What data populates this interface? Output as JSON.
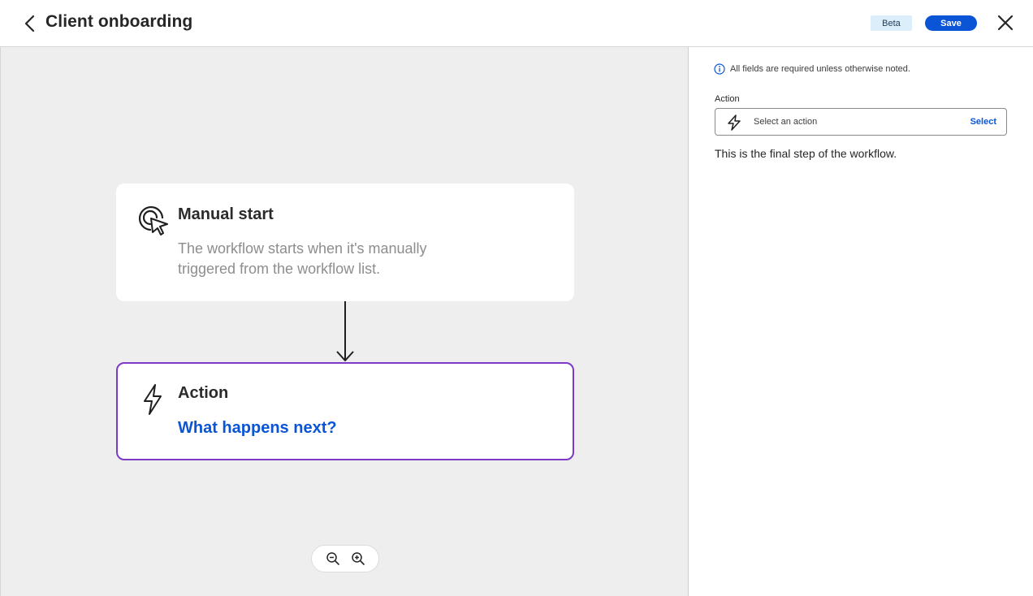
{
  "header": {
    "title": "Client onboarding",
    "beta_label": "Beta",
    "save_label": "Save"
  },
  "canvas": {
    "manual_start": {
      "title": "Manual start",
      "description": "The workflow starts when it's manually triggered from the workflow list."
    },
    "action_card": {
      "title": "Action",
      "link": "What happens next?"
    }
  },
  "panel": {
    "info": "All fields are required unless otherwise noted.",
    "action_label": "Action",
    "action_placeholder": "Select an action",
    "select_link": "Select",
    "final_note": "This is the final step of the workflow."
  },
  "colors": {
    "accent": "#0a54d6",
    "selected_border": "#7c3ac6",
    "canvas_bg": "#eeeeee"
  }
}
